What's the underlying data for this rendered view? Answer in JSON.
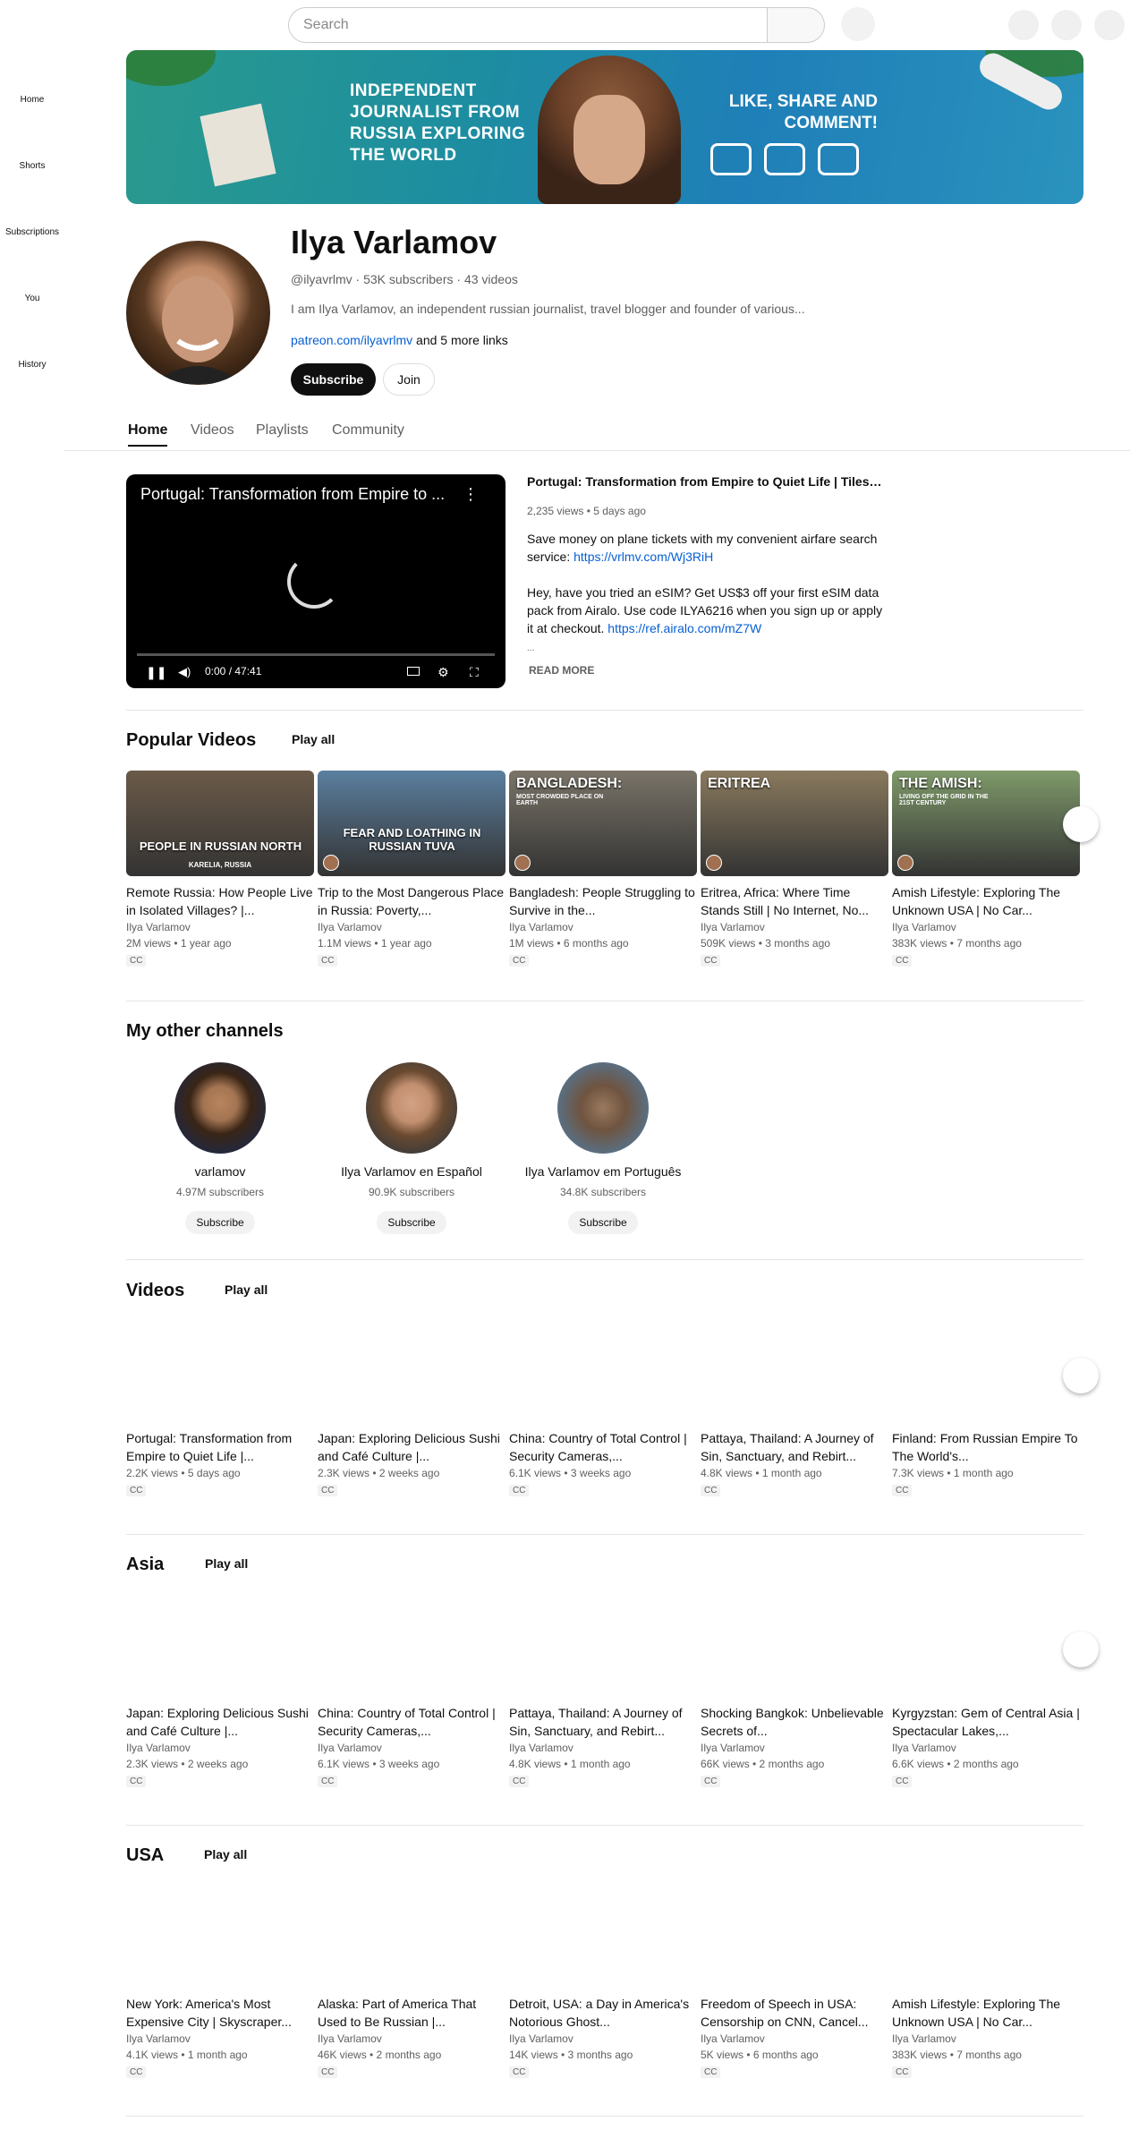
{
  "header": {
    "search_placeholder": "Search"
  },
  "sidebar": {
    "items": [
      {
        "label": "Home"
      },
      {
        "label": "Shorts"
      },
      {
        "label": "Subscriptions"
      },
      {
        "label": "You"
      },
      {
        "label": "History"
      }
    ]
  },
  "banner": {
    "headline": "INDEPENDENT JOURNALIST FROM RUSSIA EXPLORING THE WORLD",
    "cta": "LIKE, SHARE AND COMMENT!"
  },
  "channel": {
    "name": "Ilya Varlamov",
    "handle": "@ilyavrlmv",
    "subscribers": "53K subscribers",
    "videos": "43 videos",
    "description": "I am Ilya Varlamov, an independent russian journalist, travel blogger and founder of various...",
    "link": "patreon.com/ilyavrlmv",
    "more_links": "and 5 more links",
    "subscribe_label": "Subscribe",
    "join_label": "Join"
  },
  "tabs": [
    {
      "label": "Home"
    },
    {
      "label": "Videos"
    },
    {
      "label": "Playlists"
    },
    {
      "label": "Community"
    }
  ],
  "featured": {
    "title": "Portugal: Transformation from Empire to Quiet Life | Tiles, Fad...",
    "player_title": "Portugal: Transformation from Empire to ...",
    "time": "0:00 / 47:41",
    "meta": "2,235 views • 5 days ago",
    "desc1": "Save money on plane tickets with my convenient airfare search service: ",
    "link1": "https://vrlmv.com/Wj3RiH",
    "desc2": "Hey, have you tried an eSIM? Get US$3 off your first eSIM data pack from Airalo. Use code ILYA6216 when you sign up or apply it at checkout. ",
    "link2": "https://ref.airalo.com/mZ7W",
    "ellipsis": "...",
    "read_more": "READ MORE"
  },
  "popular": {
    "title": "Popular Videos",
    "play_all": "Play all",
    "items": [
      {
        "thumb_text": "PEOPLE IN RUSSIAN NORTH",
        "thumb_sub": "KARELIA, RUSSIA",
        "title": "Remote Russia: How People Live in Isolated Villages? |...",
        "channel": "Ilya Varlamov",
        "meta": "2M views • 1 year ago",
        "cc": "CC",
        "bg": "#6b5a48"
      },
      {
        "thumb_text": "FEAR AND LOATHING IN RUSSIAN TUVA",
        "thumb_sub": "",
        "title": "Trip to the Most Dangerous Place in Russia: Poverty,...",
        "channel": "Ilya Varlamov",
        "meta": "1.1M views • 1 year ago",
        "cc": "CC",
        "bg": "#5b7fa0"
      },
      {
        "thumb_text": "BANGLADESH:",
        "thumb_sub": "MOST CROWDED PLACE ON EARTH",
        "title": "Bangladesh: People Struggling to Survive in the...",
        "channel": "Ilya Varlamov",
        "meta": "1M views • 6 months ago",
        "cc": "CC",
        "bg": "#7a7468"
      },
      {
        "thumb_text": "ERITREA",
        "thumb_sub": "",
        "title": "Eritrea, Africa: Where Time Stands Still | No Internet, No...",
        "channel": "Ilya Varlamov",
        "meta": "509K views • 3 months ago",
        "cc": "CC",
        "bg": "#8a7a5e"
      },
      {
        "thumb_text": "THE AMISH:",
        "thumb_sub": "LIVING OFF THE GRID IN THE 21ST CENTURY",
        "title": "Amish Lifestyle: Exploring The Unknown USA | No Car...",
        "channel": "Ilya Varlamov",
        "meta": "383K views • 7 months ago",
        "cc": "CC",
        "bg": "#7f9a6a"
      }
    ]
  },
  "other_channels": {
    "title": "My other channels",
    "items": [
      {
        "name": "varlamov",
        "subs": "4.97M subscribers",
        "button": "Subscribe"
      },
      {
        "name": "Ilya Varlamov en Español",
        "subs": "90.9K subscribers",
        "button": "Subscribe"
      },
      {
        "name": "Ilya Varlamov em Português",
        "subs": "34.8K subscribers",
        "button": "Subscribe"
      }
    ]
  },
  "videos": {
    "title": "Videos",
    "play_all": "Play all",
    "items": [
      {
        "title": "Portugal: Transformation from Empire to Quiet Life |...",
        "meta": "2.2K views • 5 days ago",
        "cc": "CC"
      },
      {
        "title": "Japan: Exploring Delicious Sushi and Café Culture |...",
        "meta": "2.3K views • 2 weeks ago",
        "cc": "CC"
      },
      {
        "title": "China: Country of Total Control | Security Cameras,...",
        "meta": "6.1K views • 3 weeks ago",
        "cc": "CC"
      },
      {
        "title": "Pattaya, Thailand: A Journey of Sin, Sanctuary, and Rebirt...",
        "meta": "4.8K views • 1 month ago",
        "cc": "CC"
      },
      {
        "title": "Finland: From Russian Empire To The World's...",
        "meta": "7.3K views • 1 month ago",
        "cc": "CC"
      }
    ]
  },
  "asia": {
    "title": "Asia",
    "play_all": "Play all",
    "items": [
      {
        "title": "Japan: Exploring Delicious Sushi and Café Culture |...",
        "channel": "Ilya Varlamov",
        "meta": "2.3K views • 2 weeks ago",
        "cc": "CC"
      },
      {
        "title": "China: Country of Total Control | Security Cameras,...",
        "channel": "Ilya Varlamov",
        "meta": "6.1K views • 3 weeks ago",
        "cc": "CC"
      },
      {
        "title": "Pattaya, Thailand: A Journey of Sin, Sanctuary, and Rebirt...",
        "channel": "Ilya Varlamov",
        "meta": "4.8K views • 1 month ago",
        "cc": "CC"
      },
      {
        "title": "Shocking Bangkok: Unbelievable Secrets of...",
        "channel": "Ilya Varlamov",
        "meta": "66K views • 2 months ago",
        "cc": "CC"
      },
      {
        "title": "Kyrgyzstan: Gem of Central Asia | Spectacular Lakes,...",
        "channel": "Ilya Varlamov",
        "meta": "6.6K views • 2 months ago",
        "cc": "CC"
      }
    ]
  },
  "usa": {
    "title": "USA",
    "play_all": "Play all",
    "items": [
      {
        "title": "New York: America's Most Expensive City | Skyscraper...",
        "channel": "Ilya Varlamov",
        "meta": "4.1K views • 1 month ago",
        "cc": "CC"
      },
      {
        "title": "Alaska: Part of America That Used to Be Russian |...",
        "channel": "Ilya Varlamov",
        "meta": "46K views • 2 months ago",
        "cc": "CC"
      },
      {
        "title": "Detroit, USA: a Day in America's Notorious Ghost...",
        "channel": "Ilya Varlamov",
        "meta": "14K views • 3 months ago",
        "cc": "CC"
      },
      {
        "title": "Freedom of Speech in USA: Censorship on CNN, Cancel...",
        "channel": "Ilya Varlamov",
        "meta": "5K views • 6 months ago",
        "cc": "CC"
      },
      {
        "title": "Amish Lifestyle: Exploring The Unknown USA | No Car...",
        "channel": "Ilya Varlamov",
        "meta": "383K views • 7 months ago",
        "cc": "CC"
      }
    ]
  }
}
